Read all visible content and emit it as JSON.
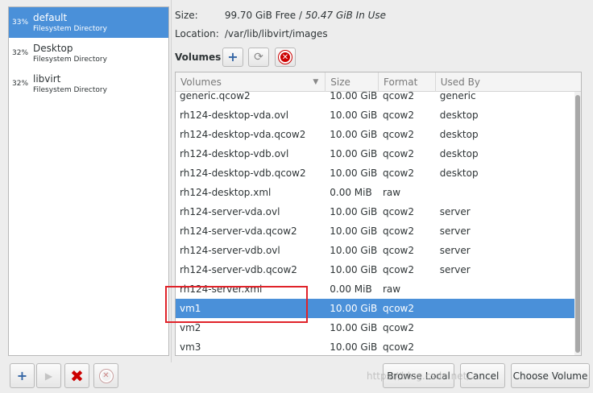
{
  "pools": [
    {
      "percent": "33%",
      "name": "default",
      "type": "Filesystem Directory",
      "selected": true
    },
    {
      "percent": "32%",
      "name": "Desktop",
      "type": "Filesystem Directory",
      "selected": false
    },
    {
      "percent": "32%",
      "name": "libvirt",
      "type": "Filesystem Directory",
      "selected": false
    }
  ],
  "details": {
    "size_label": "Size:",
    "free": "99.70 GiB Free",
    "separator": " / ",
    "in_use": "50.47 GiB In Use",
    "location_label": "Location:",
    "location": "/var/lib/libvirt/images"
  },
  "volumes_label": "Volumes",
  "table": {
    "headers": [
      "Volumes",
      "Size",
      "Format",
      "Used By"
    ],
    "rows": [
      {
        "name": "generic.qcow2",
        "size": "10.00 GiB",
        "format": "qcow2",
        "used_by": "generic"
      },
      {
        "name": "rh124-desktop-vda.ovl",
        "size": "10.00 GiB",
        "format": "qcow2",
        "used_by": "desktop"
      },
      {
        "name": "rh124-desktop-vda.qcow2",
        "size": "10.00 GiB",
        "format": "qcow2",
        "used_by": "desktop"
      },
      {
        "name": "rh124-desktop-vdb.ovl",
        "size": "10.00 GiB",
        "format": "qcow2",
        "used_by": "desktop"
      },
      {
        "name": "rh124-desktop-vdb.qcow2",
        "size": "10.00 GiB",
        "format": "qcow2",
        "used_by": "desktop"
      },
      {
        "name": "rh124-desktop.xml",
        "size": "0.00 MiB",
        "format": "raw",
        "used_by": ""
      },
      {
        "name": "rh124-server-vda.ovl",
        "size": "10.00 GiB",
        "format": "qcow2",
        "used_by": "server"
      },
      {
        "name": "rh124-server-vda.qcow2",
        "size": "10.00 GiB",
        "format": "qcow2",
        "used_by": "server"
      },
      {
        "name": "rh124-server-vdb.ovl",
        "size": "10.00 GiB",
        "format": "qcow2",
        "used_by": "server"
      },
      {
        "name": "rh124-server-vdb.qcow2",
        "size": "10.00 GiB",
        "format": "qcow2",
        "used_by": "server"
      },
      {
        "name": "rh124-server.xml",
        "size": "0.00 MiB",
        "format": "raw",
        "used_by": ""
      },
      {
        "name": "vm1",
        "size": "10.00 GiB",
        "format": "qcow2",
        "used_by": "",
        "selected": true
      },
      {
        "name": "vm2",
        "size": "10.00 GiB",
        "format": "qcow2",
        "used_by": ""
      },
      {
        "name": "vm3",
        "size": "10.00 GiB",
        "format": "qcow2",
        "used_by": ""
      }
    ]
  },
  "buttons": {
    "browse_local": "Browse Local",
    "cancel": "Cancel",
    "choose_volume": "Choose Volume"
  },
  "icons": {
    "add": "+",
    "refresh": "⟳",
    "stop": "✕",
    "play": "▶",
    "delete": "✖"
  },
  "watermark": "https://blog.csdn.net/..."
}
